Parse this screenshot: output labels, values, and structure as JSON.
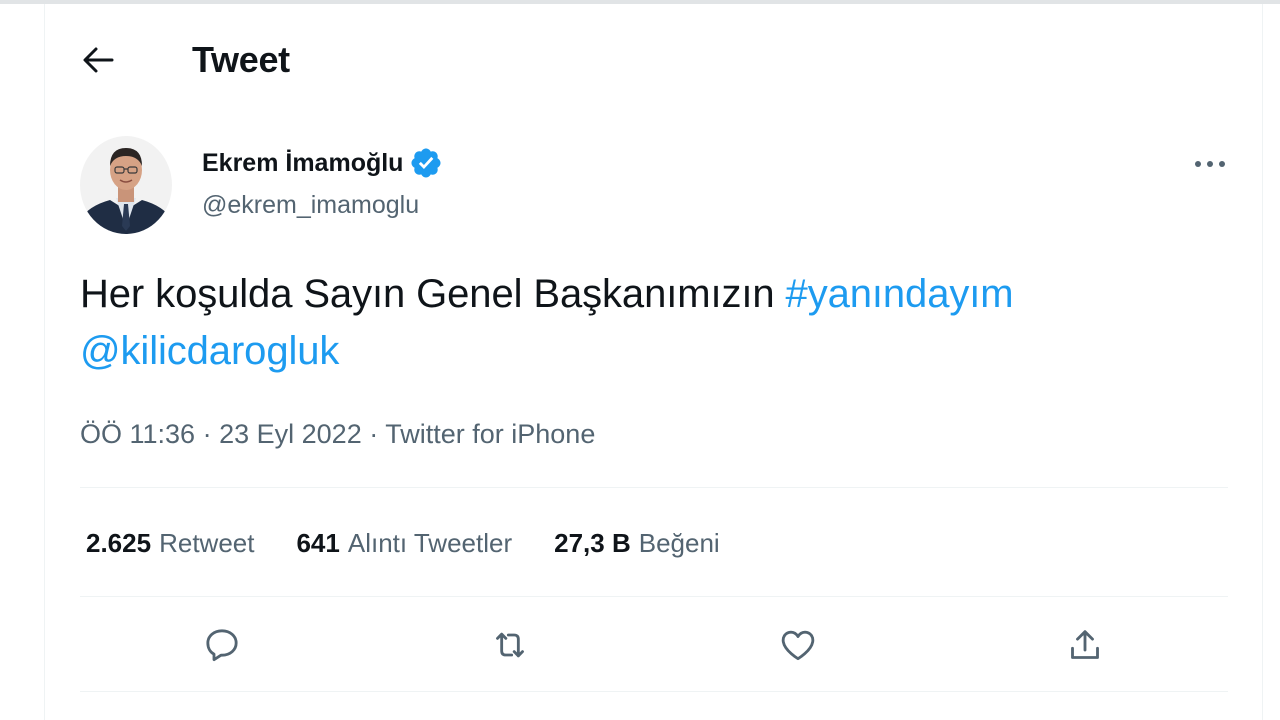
{
  "header": {
    "title": "Tweet",
    "back_icon": "arrow-left-icon"
  },
  "tweet": {
    "author": {
      "name": "Ekrem İmamoğlu",
      "handle": "@ekrem_imamoglu",
      "verified": true,
      "verified_color": "#1d9bf0"
    },
    "text": {
      "plain": "Her koşulda Sayın Genel Başkanımızın ",
      "hashtag": "#yanındayım",
      "mention": "@kilicdarogluk"
    },
    "meta": {
      "time": "ÖÖ 11:36",
      "separator": "·",
      "date": "23 Eyl 2022",
      "source": "Twitter for iPhone"
    },
    "stats": [
      {
        "value": "2.625",
        "label": "Retweet"
      },
      {
        "value": "641",
        "label": "Alıntı Tweetler"
      },
      {
        "value": "27,3 B",
        "label": "Beğeni"
      }
    ],
    "actions": [
      {
        "icon": "reply-icon"
      },
      {
        "icon": "retweet-icon"
      },
      {
        "icon": "like-icon"
      },
      {
        "icon": "share-icon"
      }
    ]
  },
  "colors": {
    "link": "#1d9bf0",
    "secondary_text": "#536471",
    "primary_text": "#0f1419",
    "divider": "#eff3f4"
  }
}
